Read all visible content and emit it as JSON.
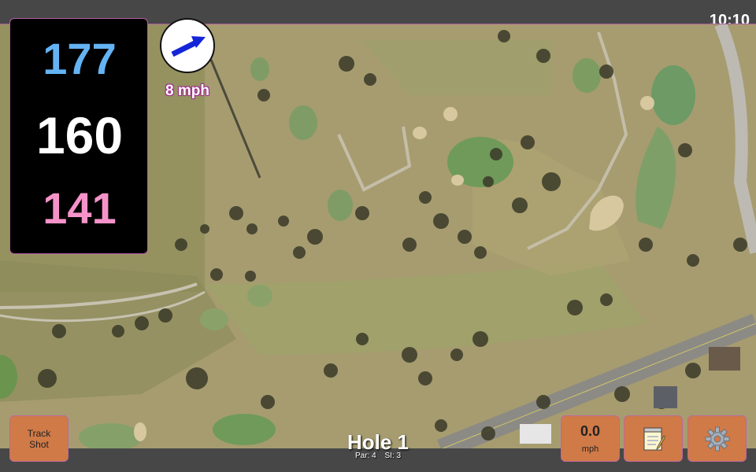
{
  "status": {
    "clock": "10:10"
  },
  "yardage": {
    "back": "177",
    "center": "160",
    "front": "141"
  },
  "wind": {
    "speed": "8 mph",
    "icon": "arrow-northeast-icon"
  },
  "hole": {
    "title": "Hole 1",
    "par": "Par: 4",
    "stroke_index": "SI: 3"
  },
  "buttons": {
    "track_shot_line1": "Track",
    "track_shot_line2": "Shot",
    "speed_value": "0.0",
    "speed_unit": "mph",
    "notes_icon": "notepad-icon",
    "settings_icon": "gear-icon"
  },
  "colors": {
    "back_yardage": "#64b3f4",
    "center_yardage": "#ffffff",
    "front_yardage": "#f593c9",
    "button_bg": "#d07a47",
    "accent_border": "#b35fa5"
  }
}
